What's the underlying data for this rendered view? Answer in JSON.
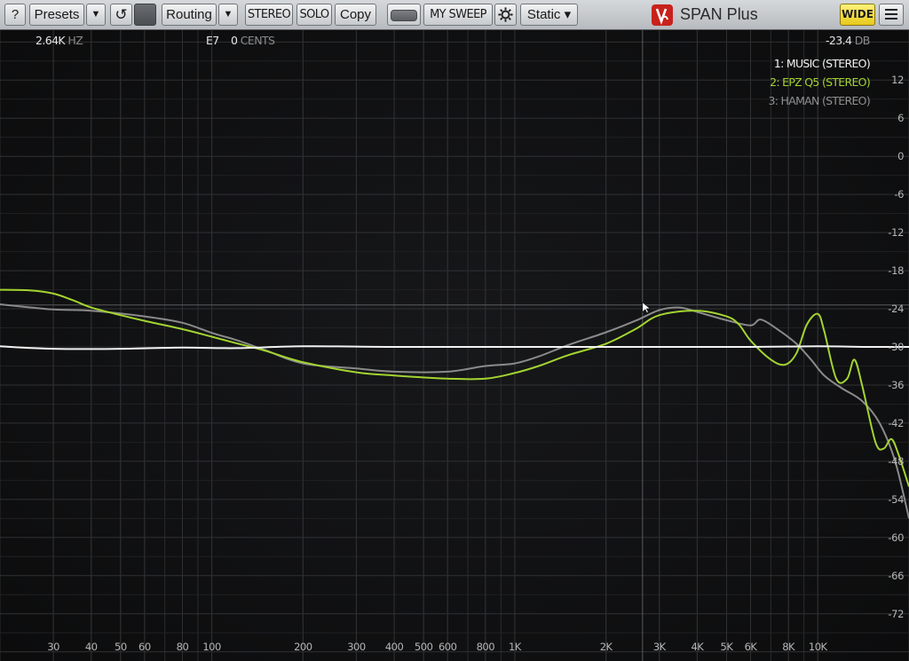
{
  "toolbar": {
    "help_label": "?",
    "presets_label": "Presets",
    "presets_arrow": "▼",
    "reset_icon": "↺",
    "routing_label": "Routing",
    "routing_arrow": "▼",
    "stereo_label": "STEREO",
    "solo_label": "SOLO",
    "copy_label": "Copy",
    "sweep_label": "MY SWEEP",
    "static_label": "Static ▾",
    "brand_name": "SPAN Plus",
    "wide_label": "WIDE",
    "menu_icon": "hamburger-menu-icon"
  },
  "readouts": {
    "freq_value": "2.64K",
    "freq_unit": "HZ",
    "note_value": "E7",
    "cents_value": "0",
    "cents_unit": "CENTS",
    "level_value": "-23.4",
    "level_unit": "DB"
  },
  "legend": {
    "items": [
      {
        "label": "1: MUSIC (STEREO)",
        "color": "#f2f2f2"
      },
      {
        "label": "2: EPZ Q5 (STEREO)",
        "color": "#a3d431"
      },
      {
        "label": "3: HAMAN (STEREO)",
        "color": "#909090"
      }
    ]
  },
  "colors": {
    "background": "#0f0f10",
    "grid": "#2a2b2d",
    "music": "#f2f2f2",
    "epz": "#a3d431",
    "haman": "#8a8a8a",
    "accent_wide": "#f5df3a",
    "brand_logo": "#c8211b"
  },
  "chart_data": {
    "type": "line",
    "xscale": "log",
    "xlim": [
      20,
      20000
    ],
    "ylim": [
      -75,
      18
    ],
    "xlabel": "",
    "ylabel": "",
    "grid": true,
    "legend_position": "top-right",
    "x_tick_labels": [
      "30",
      "40",
      "50",
      "60",
      "80",
      "100",
      "200",
      "300",
      "400",
      "500",
      "600",
      "800",
      "1K",
      "2K",
      "3K",
      "4K",
      "5K",
      "6K",
      "8K",
      "10K"
    ],
    "x_tick_values": [
      30,
      40,
      50,
      60,
      80,
      100,
      200,
      300,
      400,
      500,
      600,
      800,
      1000,
      2000,
      3000,
      4000,
      5000,
      6000,
      8000,
      10000
    ],
    "y_tick_values": [
      12,
      6,
      0,
      -6,
      -12,
      -18,
      -24,
      -30,
      -36,
      -42,
      -48,
      -54,
      -60,
      -66,
      -72
    ],
    "y_tick_labels": [
      "12",
      "6",
      "0",
      "-6",
      "-12",
      "-18",
      "-24",
      "-30",
      "-36",
      "-42",
      "-48",
      "-54",
      "-60",
      "-66",
      "-72"
    ],
    "cursor": {
      "x": 2640,
      "y": -23.4
    },
    "series": [
      {
        "name": "1: MUSIC (STEREO)",
        "x": [
          20,
          30,
          50,
          80,
          120,
          200,
          400,
          800,
          2000,
          4000,
          6000,
          10000,
          15000,
          20000
        ],
        "y": [
          -29.9,
          -30.3,
          -30.3,
          -30.1,
          -30.2,
          -29.9,
          -30.0,
          -30.0,
          -30.0,
          -30.0,
          -30.0,
          -29.9,
          -30.0,
          -30.0
        ]
      },
      {
        "name": "2: EPZ Q5 (STEREO)",
        "x": [
          20,
          25,
          30,
          35,
          40,
          50,
          60,
          80,
          100,
          120,
          150,
          200,
          300,
          400,
          600,
          800,
          1000,
          1200,
          1500,
          2000,
          2500,
          3000,
          4000,
          5000,
          5500,
          6000,
          7000,
          7800,
          8500,
          9200,
          10000,
          10500,
          11500,
          12500,
          13200,
          14000,
          15500,
          16500,
          17500,
          18500,
          20000
        ],
        "y": [
          -21.0,
          -21.1,
          -21.6,
          -22.7,
          -23.8,
          -25.0,
          -25.9,
          -27.2,
          -28.4,
          -29.4,
          -30.6,
          -32.4,
          -34.0,
          -34.5,
          -35.0,
          -35.0,
          -34.1,
          -33.0,
          -31.3,
          -29.5,
          -27.2,
          -25.0,
          -24.3,
          -25.2,
          -26.5,
          -29.0,
          -32.0,
          -32.8,
          -31.0,
          -26.5,
          -24.8,
          -27.5,
          -35.0,
          -35.0,
          -32.0,
          -36.0,
          -45.0,
          -46.0,
          -44.5,
          -47.0,
          -52.0
        ]
      },
      {
        "name": "3: HAMAN (STEREO)",
        "x": [
          20,
          30,
          40,
          60,
          80,
          100,
          120,
          150,
          200,
          300,
          400,
          600,
          800,
          1000,
          1200,
          1500,
          2000,
          2500,
          3000,
          3500,
          4000,
          5000,
          6000,
          6500,
          7500,
          8500,
          9500,
          10500,
          12000,
          14000,
          16000,
          18000,
          20000
        ],
        "y": [
          -23.3,
          -24.1,
          -24.3,
          -25.2,
          -26.2,
          -27.8,
          -28.9,
          -30.5,
          -32.6,
          -33.4,
          -33.9,
          -33.9,
          -33.0,
          -32.6,
          -31.5,
          -29.7,
          -27.7,
          -25.9,
          -24.2,
          -23.8,
          -24.5,
          -25.8,
          -26.6,
          -25.7,
          -27.5,
          -29.5,
          -32.0,
          -34.5,
          -36.5,
          -38.5,
          -42.0,
          -48.0,
          -57.0
        ]
      }
    ]
  }
}
